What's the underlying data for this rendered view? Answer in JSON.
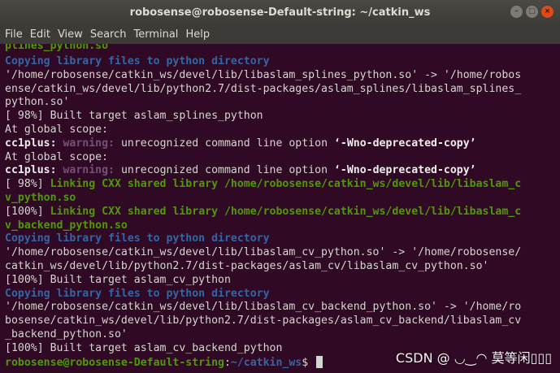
{
  "window": {
    "title": "robosense@robosense-Default-string: ~/catkin_ws",
    "controls": {
      "minimize": "–",
      "maximize": "□",
      "close": "×"
    }
  },
  "menu": [
    "File",
    "Edit",
    "View",
    "Search",
    "Terminal",
    "Help"
  ],
  "terminal": {
    "lines": [
      [
        {
          "t": "plines_python.so",
          "c": "green"
        }
      ],
      [
        {
          "t": "Copying library files to python directory",
          "c": "blue"
        }
      ],
      [
        {
          "t": "'/home/robosense/catkin_ws/devel/lib/libaslam_splines_python.so' -> '/home/robos"
        }
      ],
      [
        {
          "t": "ense/catkin_ws/devel/lib/python2.7/dist-packages/aslam_splines/libaslam_splines_"
        }
      ],
      [
        {
          "t": "python.so'"
        }
      ],
      [
        {
          "t": "[ 98%] Built target aslam_splines_python"
        }
      ],
      [
        {
          "t": "At global scope:"
        }
      ],
      [
        {
          "t": "cc1plus: ",
          "c": "bold"
        },
        {
          "t": "warning: ",
          "c": "mag"
        },
        {
          "t": "unrecognized command line option "
        },
        {
          "t": "‘-Wno-deprecated-copy’",
          "c": "bold"
        }
      ],
      [
        {
          "t": "At global scope:"
        }
      ],
      [
        {
          "t": "cc1plus: ",
          "c": "bold"
        },
        {
          "t": "warning: ",
          "c": "mag"
        },
        {
          "t": "unrecognized command line option "
        },
        {
          "t": "‘-Wno-deprecated-copy’",
          "c": "bold"
        }
      ],
      [
        {
          "t": "[ 98%] "
        },
        {
          "t": "Linking CXX shared library /home/robosense/catkin_ws/devel/lib/libaslam_c",
          "c": "green"
        }
      ],
      [
        {
          "t": "v_python.so",
          "c": "green"
        }
      ],
      [
        {
          "t": "[100%] "
        },
        {
          "t": "Linking CXX shared library /home/robosense/catkin_ws/devel/lib/libaslam_c",
          "c": "green"
        }
      ],
      [
        {
          "t": "v_backend_python.so",
          "c": "green"
        }
      ],
      [
        {
          "t": "Copying library files to python directory",
          "c": "blue"
        }
      ],
      [
        {
          "t": "'/home/robosense/catkin_ws/devel/lib/libaslam_cv_python.so' -> '/home/robosense/"
        }
      ],
      [
        {
          "t": "catkin_ws/devel/lib/python2.7/dist-packages/aslam_cv/libaslam_cv_python.so'"
        }
      ],
      [
        {
          "t": "[100%] Built target aslam_cv_python"
        }
      ],
      [
        {
          "t": "Copying library files to python directory",
          "c": "blue"
        }
      ],
      [
        {
          "t": "'/home/robosense/catkin_ws/devel/lib/libaslam_cv_backend_python.so' -> '/home/ro"
        }
      ],
      [
        {
          "t": "bosense/catkin_ws/devel/lib/python2.7/dist-packages/aslam_cv_backend/libaslam_cv"
        }
      ],
      [
        {
          "t": "_backend_python.so'"
        }
      ],
      [
        {
          "t": "[100%] Built target aslam_cv_backend_python"
        }
      ],
      [
        {
          "t": "robosense@robosense-Default-string",
          "c": "green"
        },
        {
          "t": ":"
        },
        {
          "t": "~/catkin_ws",
          "c": "blue"
        },
        {
          "t": "$ "
        }
      ]
    ]
  },
  "watermark": "CSDN @ ◡‿◠ 莫等闲▯▯▯",
  "colors": {
    "background": "#300a24",
    "text": "#d3d7cf",
    "green": "#4e9a06",
    "blue": "#3465a4",
    "magenta": "#75507b",
    "close_button": "#df4a16"
  }
}
